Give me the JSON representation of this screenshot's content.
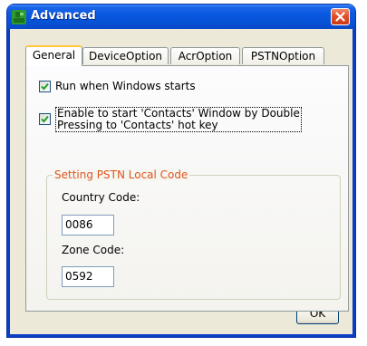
{
  "window": {
    "title": "Advanced"
  },
  "tabs": [
    {
      "label": "General",
      "active": true
    },
    {
      "label": "DeviceOption",
      "active": false
    },
    {
      "label": "AcrOption",
      "active": false
    },
    {
      "label": "PSTNOption",
      "active": false
    }
  ],
  "general": {
    "run_on_startup": {
      "label": "Run when Windows starts",
      "checked": true
    },
    "contacts_hotkey": {
      "line1": "Enable to start 'Contacts' Window by Double",
      "line2": "Pressing to 'Contacts' hot key",
      "checked": true
    },
    "pstn_group": {
      "legend": "Setting PSTN Local Code",
      "country_code_label": "Country Code:",
      "country_code_value": "0086",
      "zone_code_label": "Zone Code:",
      "zone_code_value": "0592"
    }
  },
  "buttons": {
    "ok_label": "OK"
  },
  "colors": {
    "accent_legend": "#e0561d",
    "titlebar": "#0a58e0",
    "active_tab_highlight": "#ffc73c"
  }
}
